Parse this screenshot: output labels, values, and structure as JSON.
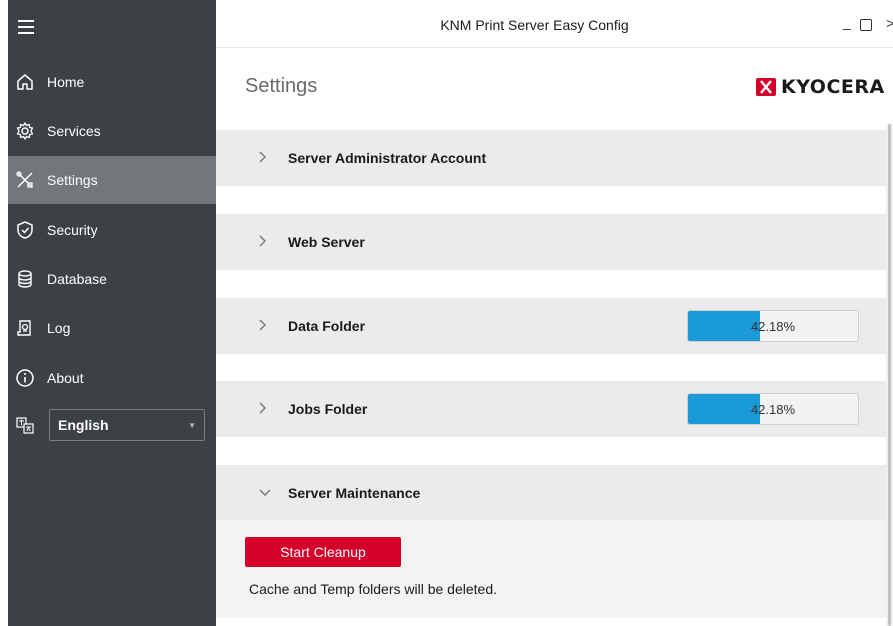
{
  "window": {
    "title": "KNM Print Server Easy Config",
    "minimize": "_",
    "close": ">"
  },
  "sidebar": {
    "items": [
      {
        "label": "Home",
        "icon": "home-icon"
      },
      {
        "label": "Services",
        "icon": "gear-icon"
      },
      {
        "label": "Settings",
        "icon": "tools-icon",
        "active": true
      },
      {
        "label": "Security",
        "icon": "shield-check-icon"
      },
      {
        "label": "Database",
        "icon": "database-icon"
      },
      {
        "label": "Log",
        "icon": "log-icon"
      },
      {
        "label": "About",
        "icon": "info-icon"
      }
    ],
    "language": {
      "selected": "English",
      "icon": "translate-icon"
    }
  },
  "page": {
    "title": "Settings",
    "logo": "KYOCERA"
  },
  "sections": [
    {
      "label": "Server Administrator Account",
      "expanded": false
    },
    {
      "label": "Web Server",
      "expanded": false
    },
    {
      "label": "Data Folder",
      "expanded": false,
      "usage_label": "42.18%",
      "usage_fraction": 0.4218
    },
    {
      "label": "Jobs Folder",
      "expanded": false,
      "usage_label": "42.18%",
      "usage_fraction": 0.4218
    },
    {
      "label": "Server Maintenance",
      "expanded": true
    }
  ],
  "maintenance": {
    "button_label": "Start Cleanup",
    "note": "Cache and Temp folders will be deleted."
  },
  "colors": {
    "sidebar_bg": "#3d4146",
    "sidebar_active": "#73777c",
    "accent_red": "#d3002a",
    "progress_blue": "#1a9bd8"
  }
}
